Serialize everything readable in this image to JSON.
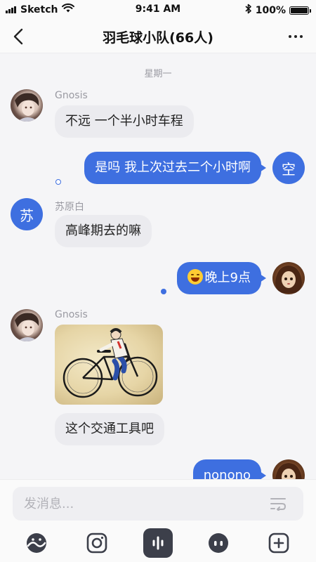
{
  "status_bar": {
    "carrier": "Sketch",
    "time": "9:41 AM",
    "battery": "100%",
    "battery_level": 1.0,
    "icons": [
      "signal-icon",
      "wifi-icon",
      "bluetooth-icon",
      "battery-icon"
    ]
  },
  "nav": {
    "title": "羽毛球小队(66人)",
    "back_icon": "chevron-left-icon",
    "more_icon": "more-dots-icon"
  },
  "chat": {
    "date_divider": "星期一",
    "messages": [
      {
        "sender": "Gnosis",
        "direction": "in",
        "avatar": "photo-avatar",
        "text": "不远 一个半小时车程"
      },
      {
        "sender": "空",
        "direction": "out",
        "avatar_letter": "空",
        "text": "是吗 我上次过去二个小时啊",
        "read": false
      },
      {
        "sender": "苏原白",
        "direction": "in",
        "avatar_letter": "苏",
        "text": "高峰期去的嘛"
      },
      {
        "sender": "me",
        "direction": "out",
        "avatar": "photo-avatar",
        "emoji": "tears-of-joy-emoji",
        "text": "晚上9点",
        "read": true
      },
      {
        "sender": "Gnosis",
        "direction": "in",
        "avatar": "photo-avatar",
        "image": "bicycle-illustration"
      },
      {
        "sender": "Gnosis",
        "direction": "in",
        "text": "这个交通工具吧"
      },
      {
        "sender": "me",
        "direction": "out",
        "avatar": "photo-avatar",
        "text": "nonono"
      }
    ]
  },
  "composer": {
    "placeholder": "发消息...",
    "input_icon": "send-format-icon",
    "tools": [
      "sticker-icon",
      "camera-icon",
      "voice-icon",
      "emoji-icon",
      "plus-icon"
    ]
  },
  "colors": {
    "accent": "#3e6fe0",
    "bubble_in": "#ebebef",
    "background": "#f5f5f7"
  }
}
